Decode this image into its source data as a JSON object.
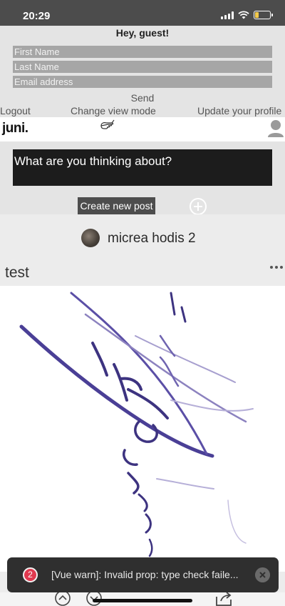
{
  "status_bar": {
    "time": "20:29",
    "battery_level": 0.25,
    "battery_color": "#f2c94c"
  },
  "guest_form": {
    "greeting": "Hey, guest!",
    "first_name_placeholder": "First Name",
    "last_name_placeholder": "Last Name",
    "email_placeholder": "Email address",
    "send_label": "Send"
  },
  "menu": {
    "logout": "Logout",
    "change_view_mode": "Change view mode",
    "update_profile": "Update your profile"
  },
  "header": {
    "logo": "juni.",
    "view_mode_icon": "hand-pointer-icon",
    "profile_icon": "user-avatar-icon"
  },
  "composer": {
    "prompt": "What are you thinking about?",
    "create_label": "Create new post",
    "add_icon": "plus-circle-icon"
  },
  "post": {
    "author": "micrea hodis 2",
    "title": "test",
    "more_icon": "more-dots-icon",
    "image": "handwritten-signature-drawing"
  },
  "toast": {
    "count": "2",
    "message": "[Vue warn]: Invalid prop: type check faile...",
    "badge_color": "#e0394f"
  },
  "colors": {
    "panel_gray": "#e4e4e4",
    "field_gray": "#a6a6a6",
    "dark": "#1c1c1c"
  }
}
